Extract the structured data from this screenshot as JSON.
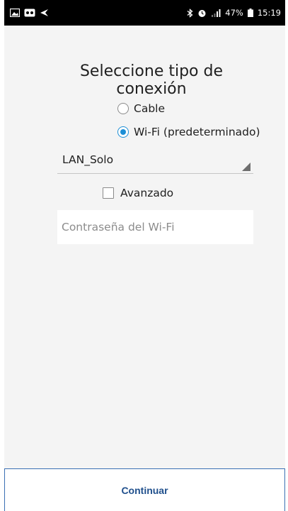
{
  "status_bar": {
    "battery_text": "47%",
    "time": "15:19",
    "icons": [
      "image-icon",
      "voicemail-icon",
      "send-icon",
      "bluetooth-icon",
      "alarm-icon",
      "signal-icon",
      "battery-icon"
    ]
  },
  "screen": {
    "title": "Seleccione tipo de conexión",
    "radios": [
      {
        "label": "Cable",
        "checked": false
      },
      {
        "label": "Wi-Fi (predeterminado)",
        "checked": true
      }
    ],
    "network_select": {
      "value": "LAN_Solo"
    },
    "advanced_checkbox": {
      "label": "Avanzado",
      "checked": false
    },
    "password_field": {
      "placeholder": "Contraseña del Wi-Fi",
      "value": ""
    },
    "continue_button": {
      "label": "Continuar"
    }
  },
  "colors": {
    "accent": "#1e8fd6",
    "button_text": "#1f4f8c",
    "button_border": "#3a6fb3",
    "background": "#f4f4f4"
  }
}
